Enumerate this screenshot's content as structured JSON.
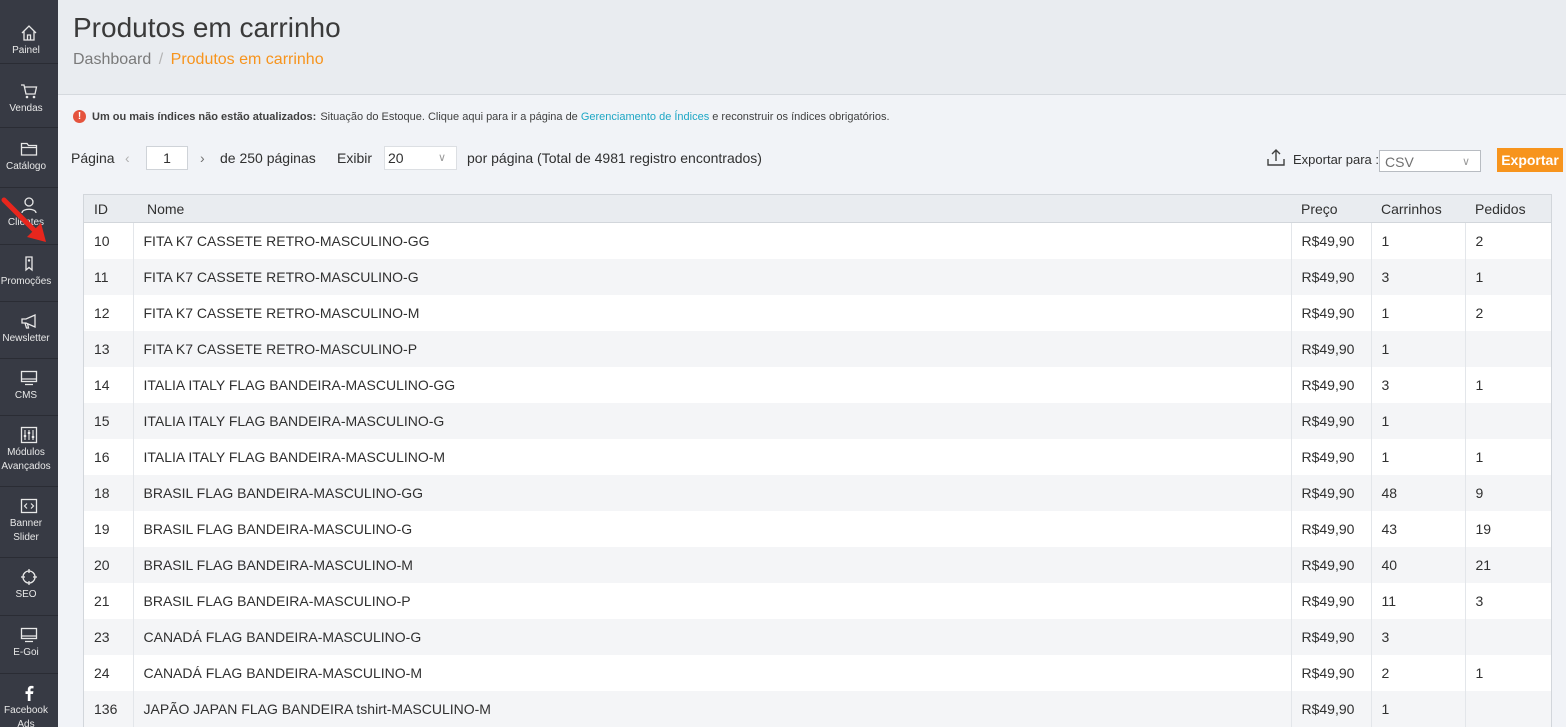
{
  "sidebar": {
    "items": [
      {
        "label": "Painel",
        "icon": "home-icon"
      },
      {
        "label": "Vendas",
        "icon": "cart-icon"
      },
      {
        "label": "Catálogo",
        "icon": "folder-icon"
      },
      {
        "label": "Clientes",
        "icon": "user-icon"
      },
      {
        "label": "Promoções",
        "icon": "tag-icon"
      },
      {
        "label": "Newsletter",
        "icon": "megaphone-icon"
      },
      {
        "label": "CMS",
        "icon": "monitor-icon"
      },
      {
        "label": "Módulos\nAvançados",
        "icon": "sliders-icon"
      },
      {
        "label": "Banner\nSlider",
        "icon": "code-icon"
      },
      {
        "label": "SEO",
        "icon": "crosshair-icon"
      },
      {
        "label": "E-Goi",
        "icon": "monitor-icon"
      },
      {
        "label": "Facebook\nAds",
        "icon": "facebook-icon"
      }
    ]
  },
  "header": {
    "title": "Produtos em carrinho",
    "breadcrumb": {
      "link": "Dashboard",
      "separator": "/",
      "current": "Produtos em carrinho"
    }
  },
  "notice": {
    "bold": "Um ou mais índices não estão atualizados:",
    "text": "Situação do Estoque. Clique aqui para ir a página de",
    "link": "Gerenciamento de Índices",
    "suffix": "e reconstruir os índices obrigatórios."
  },
  "pager": {
    "label": "Página",
    "current": "1",
    "of_label": "de 250 páginas",
    "show_label": "Exibir",
    "per_page": "20",
    "per_page_label": "por página (Total de 4981 registro encontrados)"
  },
  "export": {
    "label": "Exportar para :",
    "format": "CSV",
    "button": "Exportar"
  },
  "colors": {
    "accent": "#f7941d",
    "sidebar": "#373a44",
    "link": "#1ea7c5"
  },
  "table": {
    "columns": [
      "ID",
      "Nome",
      "Preço",
      "Carrinhos",
      "Pedidos"
    ],
    "rows": [
      {
        "id": "10",
        "nome": "FITA K7 CASSETE RETRO-MASCULINO-GG",
        "preco": "R$49,90",
        "carrinhos": "1",
        "pedidos": "2"
      },
      {
        "id": "11",
        "nome": "FITA K7 CASSETE RETRO-MASCULINO-G",
        "preco": "R$49,90",
        "carrinhos": "3",
        "pedidos": "1"
      },
      {
        "id": "12",
        "nome": "FITA K7 CASSETE RETRO-MASCULINO-M",
        "preco": "R$49,90",
        "carrinhos": "1",
        "pedidos": "2"
      },
      {
        "id": "13",
        "nome": "FITA K7 CASSETE RETRO-MASCULINO-P",
        "preco": "R$49,90",
        "carrinhos": "1",
        "pedidos": ""
      },
      {
        "id": "14",
        "nome": "ITALIA ITALY FLAG BANDEIRA-MASCULINO-GG",
        "preco": "R$49,90",
        "carrinhos": "3",
        "pedidos": "1"
      },
      {
        "id": "15",
        "nome": "ITALIA ITALY FLAG BANDEIRA-MASCULINO-G",
        "preco": "R$49,90",
        "carrinhos": "1",
        "pedidos": ""
      },
      {
        "id": "16",
        "nome": "ITALIA ITALY FLAG BANDEIRA-MASCULINO-M",
        "preco": "R$49,90",
        "carrinhos": "1",
        "pedidos": "1"
      },
      {
        "id": "18",
        "nome": "BRASIL FLAG BANDEIRA-MASCULINO-GG",
        "preco": "R$49,90",
        "carrinhos": "48",
        "pedidos": "9"
      },
      {
        "id": "19",
        "nome": "BRASIL FLAG BANDEIRA-MASCULINO-G",
        "preco": "R$49,90",
        "carrinhos": "43",
        "pedidos": "19"
      },
      {
        "id": "20",
        "nome": "BRASIL FLAG BANDEIRA-MASCULINO-M",
        "preco": "R$49,90",
        "carrinhos": "40",
        "pedidos": "21"
      },
      {
        "id": "21",
        "nome": "BRASIL FLAG BANDEIRA-MASCULINO-P",
        "preco": "R$49,90",
        "carrinhos": "11",
        "pedidos": "3"
      },
      {
        "id": "23",
        "nome": "CANADÁ FLAG BANDEIRA-MASCULINO-G",
        "preco": "R$49,90",
        "carrinhos": "3",
        "pedidos": ""
      },
      {
        "id": "24",
        "nome": "CANADÁ FLAG BANDEIRA-MASCULINO-M",
        "preco": "R$49,90",
        "carrinhos": "2",
        "pedidos": "1"
      },
      {
        "id": "136",
        "nome": "JAPÃO JAPAN FLAG BANDEIRA tshirt-MASCULINO-M",
        "preco": "R$49,90",
        "carrinhos": "1",
        "pedidos": ""
      }
    ]
  }
}
